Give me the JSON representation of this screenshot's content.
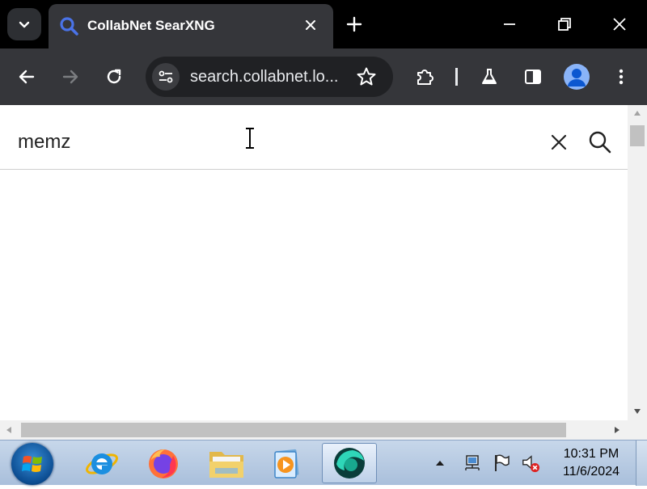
{
  "browser": {
    "tab": {
      "title": "CollabNet SearXNG"
    },
    "address_bar": {
      "url": "search.collabnet.lo..."
    }
  },
  "search": {
    "query": "memz"
  },
  "taskbar": {
    "apps": [
      "internet-explorer",
      "firefox",
      "file-explorer",
      "media-player",
      "browser-active"
    ],
    "clock": {
      "time": "10:31 PM",
      "date": "11/6/2024"
    }
  },
  "colors": {
    "tabstrip": "#000000",
    "toolbar": "#35363a",
    "omnibox": "#202124",
    "tab_accent": "#4a73e8",
    "avatar": "#8ab4f8"
  }
}
